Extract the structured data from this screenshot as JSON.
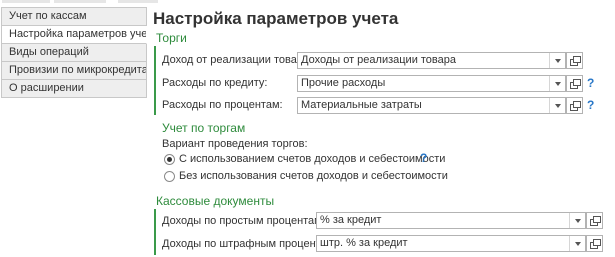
{
  "nav": {
    "items": [
      {
        "label": "Учет по кассам"
      },
      {
        "label": "Настройка параметров учета"
      },
      {
        "label": "Виды операций"
      },
      {
        "label": "Провизии по микрокредитам"
      },
      {
        "label": "О расширении"
      }
    ],
    "active_index": 1
  },
  "page_title": "Настройка параметров учета",
  "torgi": {
    "title": "Торги",
    "income": {
      "label": "Доход от реализации товара:",
      "value": "Доходы от реализации товара"
    },
    "credit_expenses": {
      "label": "Расходы по кредиту:",
      "value": "Прочие расходы"
    },
    "interest_expenses": {
      "label": "Расходы по процентам:",
      "value": "Материальные затраты"
    },
    "help_mark": "?"
  },
  "auction_accounting": {
    "title": "Учет по торгам",
    "group_label": "Вариант проведения торгов:",
    "options": [
      {
        "label": "С использованием счетов доходов и себестоимости",
        "selected": true
      },
      {
        "label": "Без использования счетов доходов и себестоимости",
        "selected": false
      }
    ],
    "help_mark": "?"
  },
  "cash_documents": {
    "title": "Кассовые документы",
    "simple_interest": {
      "label": "Доходы по простым процентам:",
      "value": "% за кредит"
    },
    "penalty_interest": {
      "label": "Доходы по штрафным процентам:",
      "value": "штр. % за кредит"
    }
  },
  "colors": {
    "section_title": "#2e8b3c",
    "section_bar": "#3a9a4a",
    "help": "#2a78c8"
  },
  "icons": {
    "dropdown": "chevron-down-icon",
    "open": "open-form-icon",
    "help": "question-icon"
  }
}
